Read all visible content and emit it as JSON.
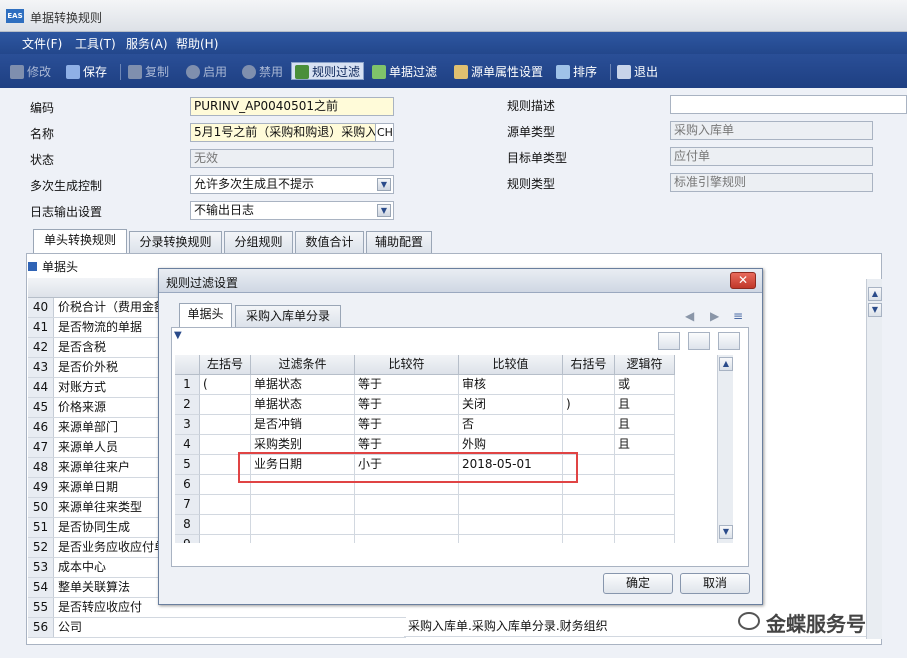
{
  "window": {
    "title": "单据转换规则",
    "logo": "EAS"
  },
  "menu": [
    "文件(F)",
    "工具(T)",
    "服务(A)",
    "帮助(H)"
  ],
  "toolbar": [
    {
      "label": "修改",
      "icon": "edit-icon",
      "disabled": true
    },
    {
      "label": "保存",
      "icon": "save-icon",
      "disabled": false
    },
    {
      "label": "复制",
      "icon": "copy-icon",
      "disabled": true
    },
    {
      "label": "启用",
      "icon": "enable-icon",
      "disabled": true
    },
    {
      "label": "禁用",
      "icon": "disable-icon",
      "disabled": true
    },
    {
      "label": "规则过滤",
      "icon": "rule-filter-icon",
      "disabled": false,
      "selected": true
    },
    {
      "label": "单据过滤",
      "icon": "bill-filter-icon",
      "disabled": false
    },
    {
      "label": "源单属性设置",
      "icon": "source-attr-icon",
      "disabled": false
    },
    {
      "label": "排序",
      "icon": "sort-icon",
      "disabled": false
    },
    {
      "label": "退出",
      "icon": "exit-icon",
      "disabled": false
    }
  ],
  "form": {
    "code_label": "编码",
    "code_value": "PURINV_AP0040501之前",
    "name_label": "名称",
    "name_value": "5月1号之前（采购和购退）采购入库单",
    "name_lang": "CH",
    "status_label": "状态",
    "status_value": "无效",
    "multi_label": "多次生成控制",
    "multi_value": "允许多次生成且不提示",
    "log_label": "日志输出设置",
    "log_value": "不输出日志",
    "desc_label": "规则描述",
    "desc_value": "",
    "src_label": "源单类型",
    "src_value": "采购入库单",
    "target_label": "目标单类型",
    "target_value": "应付单",
    "ruletype_label": "规则类型",
    "ruletype_value": "标准引擎规则"
  },
  "tabs": [
    "单头转换规则",
    "分录转换规则",
    "分组规则",
    "数值合计",
    "辅助配置"
  ],
  "group_label": "单据头",
  "rows": [
    {
      "num": "40",
      "text": "价税合计（费用金额"
    },
    {
      "num": "41",
      "text": "是否物流的单据"
    },
    {
      "num": "42",
      "text": "是否含税"
    },
    {
      "num": "43",
      "text": "是否价外税"
    },
    {
      "num": "44",
      "text": "对账方式"
    },
    {
      "num": "45",
      "text": "价格来源"
    },
    {
      "num": "46",
      "text": "来源单部门"
    },
    {
      "num": "47",
      "text": "来源单人员"
    },
    {
      "num": "48",
      "text": "来源单往来户"
    },
    {
      "num": "49",
      "text": "来源单日期"
    },
    {
      "num": "50",
      "text": "来源单往来类型"
    },
    {
      "num": "51",
      "text": "是否协同生成"
    },
    {
      "num": "52",
      "text": "是否业务应收应付单"
    },
    {
      "num": "53",
      "text": "成本中心"
    },
    {
      "num": "54",
      "text": "整单关联算法"
    },
    {
      "num": "55",
      "text": "是否转应收应付"
    },
    {
      "num": "56",
      "text": "公司"
    }
  ],
  "row56_value": "采购入库单.采购入库单分录.财务组织",
  "dialog": {
    "title": "规则过滤设置",
    "tabs": [
      "单据头",
      "采购入库单分录"
    ],
    "headers": [
      "左括号",
      "过滤条件",
      "比较符",
      "比较值",
      "右括号",
      "逻辑符"
    ],
    "rows": [
      {
        "num": "1",
        "lp": "(",
        "cond": "单据状态",
        "op": "等于",
        "val": "审核",
        "rp": "",
        "logic": "或"
      },
      {
        "num": "2",
        "lp": "",
        "cond": "单据状态",
        "op": "等于",
        "val": "关闭",
        "rp": ")",
        "logic": "且"
      },
      {
        "num": "3",
        "lp": "",
        "cond": "是否冲销",
        "op": "等于",
        "val": "否",
        "rp": "",
        "logic": "且"
      },
      {
        "num": "4",
        "lp": "",
        "cond": "采购类别",
        "op": "等于",
        "val": "外购",
        "rp": "",
        "logic": "且"
      },
      {
        "num": "5",
        "lp": "",
        "cond": "业务日期",
        "op": "小于",
        "val": "2018-05-01",
        "rp": "",
        "logic": ""
      },
      {
        "num": "6",
        "lp": "",
        "cond": "",
        "op": "",
        "val": "",
        "rp": "",
        "logic": ""
      },
      {
        "num": "7",
        "lp": "",
        "cond": "",
        "op": "",
        "val": "",
        "rp": "",
        "logic": ""
      },
      {
        "num": "8",
        "lp": "",
        "cond": "",
        "op": "",
        "val": "",
        "rp": "",
        "logic": ""
      },
      {
        "num": "9",
        "lp": "",
        "cond": "",
        "op": "",
        "val": "",
        "rp": "",
        "logic": ""
      }
    ],
    "ok": "确定",
    "cancel": "取消"
  },
  "watermark": "金蝶服务号",
  "colors": {
    "menubar": "#23478c",
    "highlight": "#e04444",
    "required": "#fffbd9"
  }
}
